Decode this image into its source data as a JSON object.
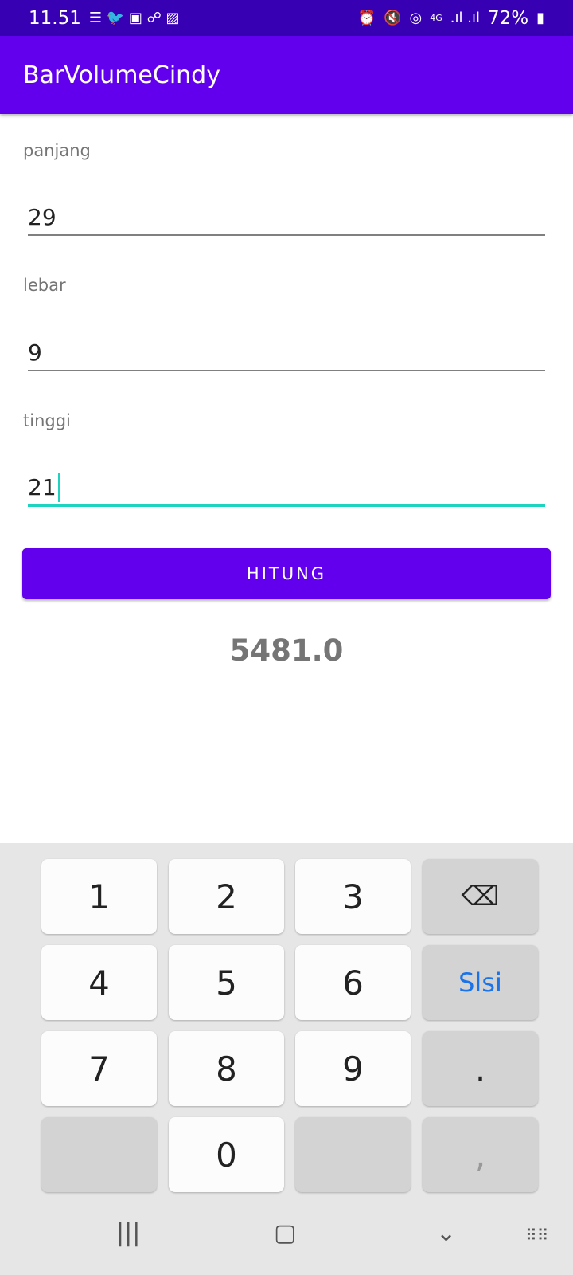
{
  "status": {
    "time": "11.51",
    "battery": "72%",
    "network": "4G"
  },
  "app": {
    "title": "BarVolumeCindy"
  },
  "form": {
    "panjang": {
      "label": "panjang",
      "value": "29"
    },
    "lebar": {
      "label": "lebar",
      "value": "9"
    },
    "tinggi": {
      "label": "tinggi",
      "value": "21"
    },
    "button": "HITUNG",
    "result": "5481.0"
  },
  "keyboard": {
    "keys": [
      "1",
      "2",
      "3",
      "4",
      "5",
      "6",
      "Slsi",
      "7",
      "8",
      "9",
      ".",
      "0",
      ","
    ],
    "accent": "#1a73e8"
  }
}
